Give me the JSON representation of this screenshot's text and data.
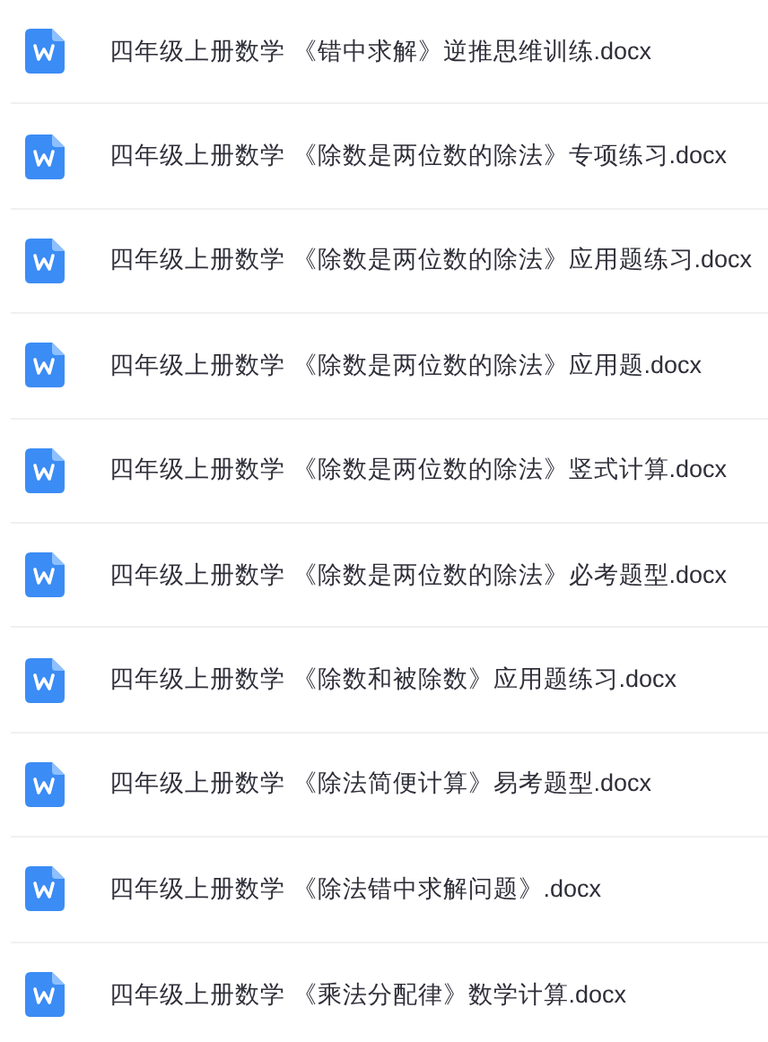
{
  "files": [
    {
      "name": "四年级上册数学 《错中求解》逆推思维训练.docx"
    },
    {
      "name": "四年级上册数学 《除数是两位数的除法》专项练习.docx"
    },
    {
      "name": "四年级上册数学 《除数是两位数的除法》应用题练习.docx"
    },
    {
      "name": "四年级上册数学 《除数是两位数的除法》应用题.docx"
    },
    {
      "name": "四年级上册数学 《除数是两位数的除法》竖式计算.docx"
    },
    {
      "name": "四年级上册数学 《除数是两位数的除法》必考题型.docx"
    },
    {
      "name": "四年级上册数学 《除数和被除数》应用题练习.docx"
    },
    {
      "name": "四年级上册数学 《除法简便计算》易考题型.docx"
    },
    {
      "name": "四年级上册数学 《除法错中求解问题》.docx"
    },
    {
      "name": "四年级上册数学 《乘法分配律》数学计算.docx"
    }
  ]
}
